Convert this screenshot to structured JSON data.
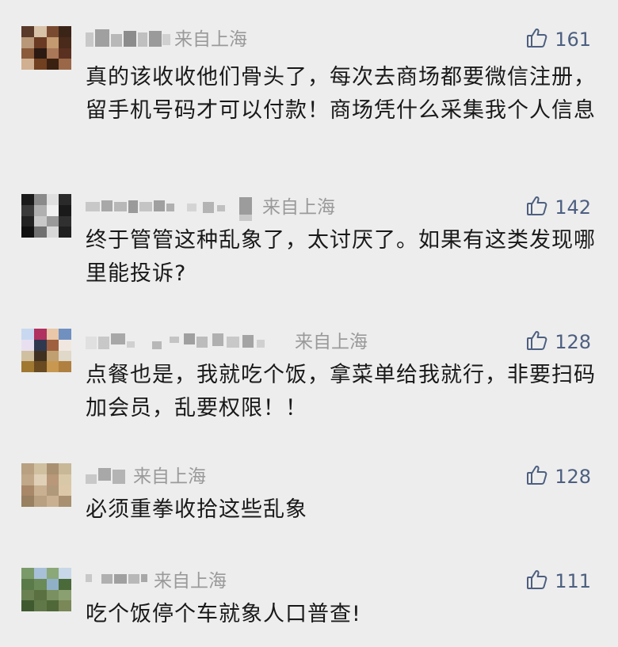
{
  "comments": [
    {
      "location": "来自上海",
      "likes": "161",
      "text": "真的该收收他们骨头了，每次去商场都要微信注册，留手机号码才可以付款！商场凭什么采集我个人信息",
      "avatar_colors": [
        "#5a3a2a",
        "#d8c2a8",
        "#7a4a30",
        "#3a2418",
        "#b89878",
        "#6a3a22",
        "#c49a70",
        "#4a2a1a",
        "#8a5a3a",
        "#2a1a12",
        "#a87858",
        "#5a3020",
        "#d0b090",
        "#704020",
        "#3a2010",
        "#9a6848"
      ]
    },
    {
      "location": "来自上海",
      "likes": "142",
      "text": "终于管管这种乱象了，太讨厌了。如果有这类发现哪里能投诉?",
      "avatar_colors": [
        "#1a1a1a",
        "#8a8a8a",
        "#e0e0e0",
        "#2a2a2a",
        "#3a3a3a",
        "#b0b0b0",
        "#f0f0f0",
        "#1a1a1a",
        "#222222",
        "#c8c8c8",
        "#9a9a9a",
        "#303030",
        "#101010",
        "#707070",
        "#d8d8d8",
        "#202020"
      ]
    },
    {
      "location": "来自上海",
      "likes": "128",
      "text": "点餐也是，我就吃个饭，拿菜单给我就行，非要扫码加会员，乱要权限！！",
      "avatar_colors": [
        "#c8d8f0",
        "#b03060",
        "#e8c8a8",
        "#7090c0",
        "#e8e0f0",
        "#303850",
        "#a06040",
        "#f0e8e0",
        "#d0c0a0",
        "#403020",
        "#c0a070",
        "#e0d8c8",
        "#a07830",
        "#6a4a20",
        "#c89850",
        "#b08040"
      ]
    },
    {
      "location": "来自上海",
      "likes": "128",
      "text": "必须重拳收拾这些乱象",
      "avatar_colors": [
        "#b8a080",
        "#d0c0a0",
        "#a89070",
        "#c8b898",
        "#c0a888",
        "#e0d0b8",
        "#b89878",
        "#d8c8a8",
        "#a88868",
        "#c8b090",
        "#b0987a",
        "#dcc8a8",
        "#988060",
        "#b8a080",
        "#c8b090",
        "#a89070"
      ]
    },
    {
      "location": "来自上海",
      "likes": "111",
      "text": "吃个饭停个车就象人口普查!",
      "avatar_colors": [
        "#7a9a6a",
        "#a8c0d8",
        "#8aa878",
        "#c8d8e8",
        "#5a7a4a",
        "#6a8a58",
        "#90b0c8",
        "#4a6a3a",
        "#6a8050",
        "#5a7040",
        "#7a9060",
        "#8aa070",
        "#405a30",
        "#607848",
        "#506838",
        "#7a8858"
      ]
    }
  ]
}
